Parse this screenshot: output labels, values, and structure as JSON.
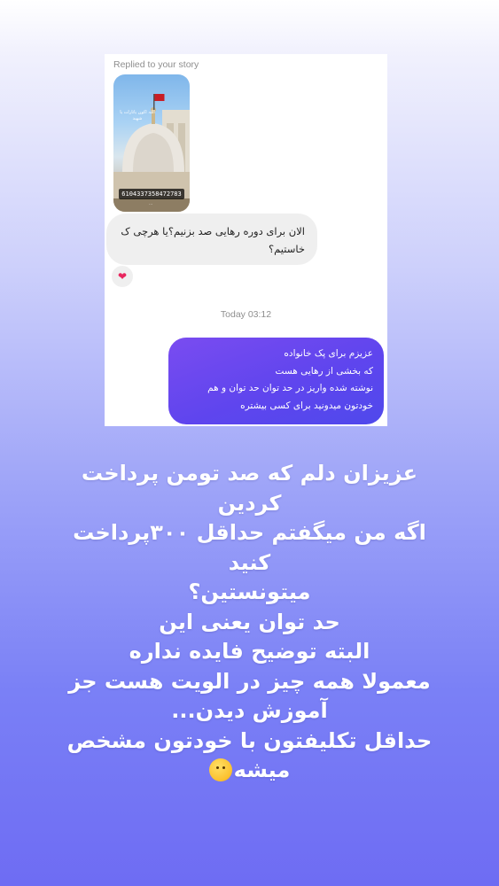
{
  "dm": {
    "replied_label": "Replied to your story",
    "story_thumbnail": {
      "card_number": "6104337358472783",
      "overlay_text": "اللہ اکون یاثارات یا شهید",
      "footer_text": "..."
    },
    "received_message": "الان برای دوره رهایی صد بزنیم؟یا هرچی ک خاستیم؟",
    "reaction": "heart",
    "timestamp": "Today 03:12",
    "sent_message_lines": [
      "عزیزم برای پک خانواده",
      "که بخشی از رهایی هست",
      "نوشته شده واریز در حد توان حد توان و هم",
      "خودتون میدونید برای کسی بیشتره"
    ]
  },
  "caption_lines": [
    "عزیزان دلم که صد تومن پرداخت",
    "کردین",
    "اگه من میگفتم حداقل ۳۰۰پرداخت",
    "کنید",
    "میتونستین؟",
    "حد توان یعنی این",
    "البته توضیح فایده نداره",
    "معمولا همه چیز در الویت هست جز",
    "آموزش دیدن...",
    "حداقل تکلیفتون با خودتون مشخص",
    "میشه"
  ],
  "caption_emoji": "saluting-face",
  "colors": {
    "sent_bubble": "#5f45ee",
    "received_bubble": "#efefef",
    "reaction_heart": "#e8265e"
  }
}
